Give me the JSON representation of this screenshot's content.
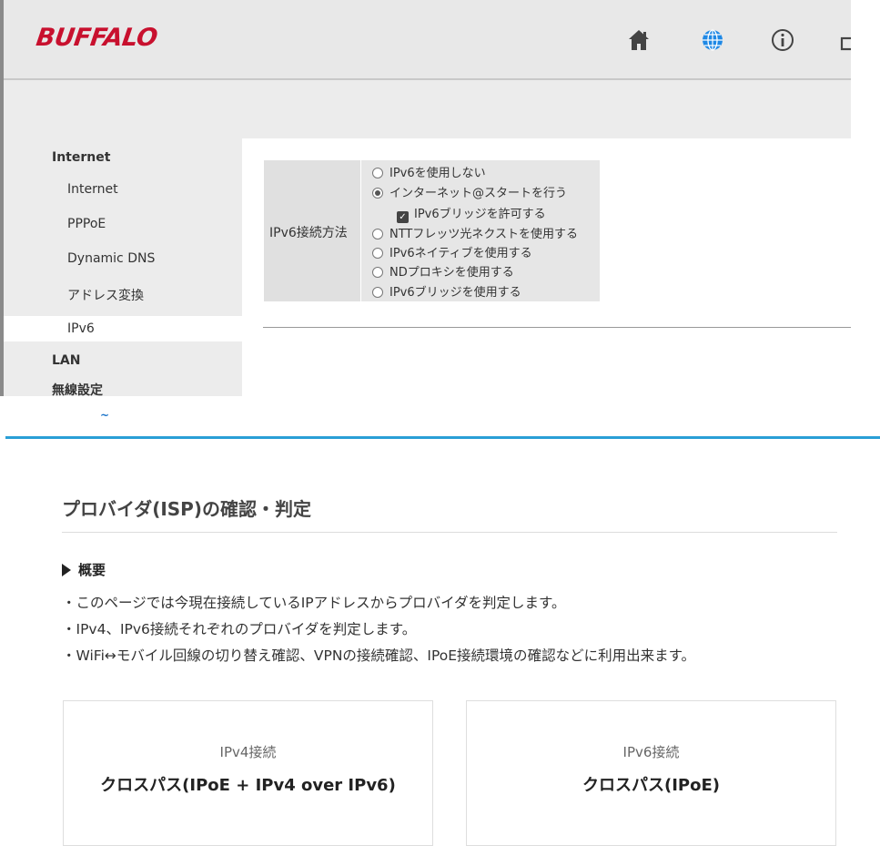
{
  "router": {
    "logo": "BUFFALO",
    "header_icons": [
      "home-icon",
      "globe-icon",
      "info-icon",
      "logout-icon"
    ],
    "sidebar": {
      "group_internet": "Internet",
      "items": [
        "Internet",
        "PPPoE",
        "Dynamic DNS",
        "アドレス変換",
        "IPv6"
      ],
      "active_item": "IPv6",
      "group_lan": "LAN",
      "group_wireless": "無線設定"
    },
    "ipv6_form": {
      "label": "IPv6接続方法",
      "options": [
        "IPv6を使用しない",
        "インターネット@スタートを行う",
        "NTTフレッツ光ネクストを使用する",
        "IPv6ネイティブを使用する",
        "NDプロキシを使用する",
        "IPv6ブリッジを使用する"
      ],
      "selected_option": "インターネット@スタートを行う",
      "bridge_checkbox_label": "IPv6ブリッジを許可する",
      "bridge_checkbox_checked": true
    }
  },
  "page": {
    "tilde": "~",
    "title": "プロバイダ(ISP)の確認・判定",
    "overview_heading": "概要",
    "bullets": [
      "・このページでは今現在接続しているIPアドレスからプロバイダを判定します。",
      "・IPv4、IPv6接続それぞれのプロバイダを判定します。",
      "・WiFi↔モバイル回線の切り替え確認、VPNの接続確認、IPoE接続環境の確認などに利用出来ます。"
    ],
    "cards": [
      {
        "label": "IPv4接続",
        "value": "クロスパス(IPoE + IPv4 over IPv6)"
      },
      {
        "label": "IPv6接続",
        "value": "クロスパス(IPoE)"
      }
    ]
  },
  "colors": {
    "brand_red": "#c8102e",
    "accent_blue": "#2a9fd6",
    "globe_blue": "#1e88e5"
  }
}
